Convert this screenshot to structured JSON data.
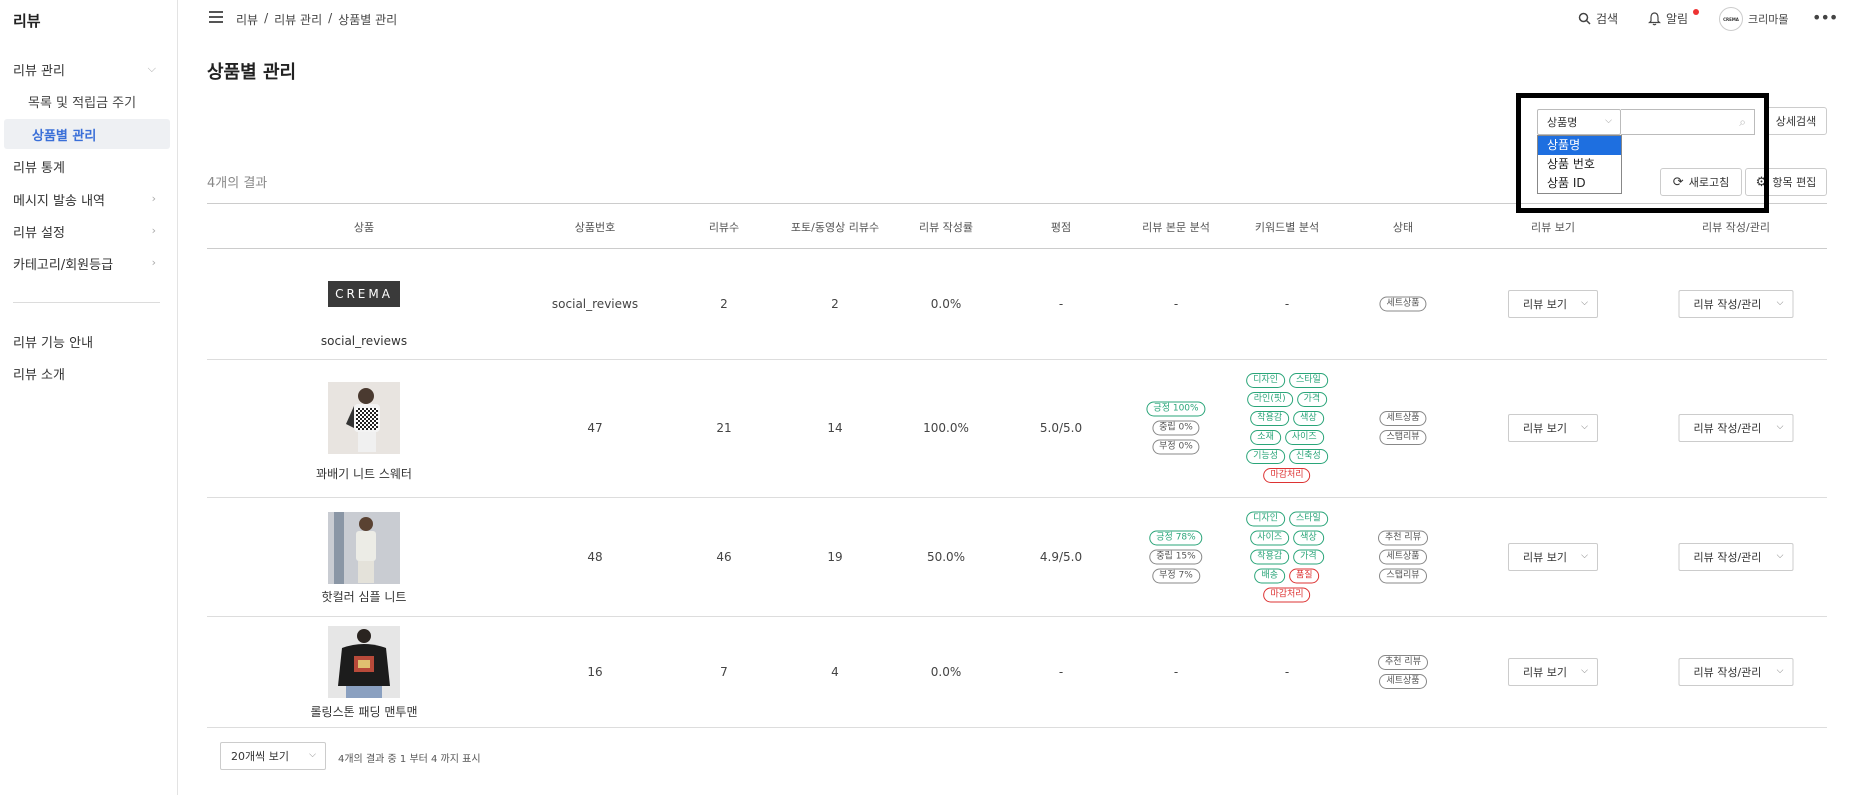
{
  "sidebar": {
    "title": "리뷰",
    "items": [
      {
        "label": "리뷰 관리"
      },
      {
        "label": "목록 및 적립금 주기"
      },
      {
        "label": "상품별 관리"
      },
      {
        "label": "리뷰 통계"
      },
      {
        "label": "메시지 발송 내역"
      },
      {
        "label": "리뷰 설정"
      },
      {
        "label": "카테고리/회원등급"
      },
      {
        "label": "리뷰 기능 안내"
      },
      {
        "label": "리뷰 소개"
      }
    ]
  },
  "topbar": {
    "breadcrumb": [
      "리뷰",
      "/",
      "리뷰 관리",
      "/",
      "상품별 관리"
    ],
    "search_label": "검색",
    "alert_label": "알림",
    "avatar_text": "CREMA",
    "user_label": "크리마몰"
  },
  "page": {
    "title": "상품별 관리"
  },
  "search": {
    "select_value": "상품명",
    "options": [
      "상품명",
      "상품 번호",
      "상품 ID"
    ],
    "detail_search_label": "상세검색",
    "refresh_label": "새로고침",
    "edit_columns_label": "항목 편집"
  },
  "results": {
    "count_label": "4개의 결과"
  },
  "table": {
    "headers": [
      "상품",
      "상품번호",
      "리뷰수",
      "포토/동영상 리뷰수",
      "리뷰 작성률",
      "평점",
      "리뷰 본문 분석",
      "키워드별 분석",
      "상태",
      "리뷰 보기",
      "리뷰 작성/관리"
    ],
    "rows": [
      {
        "name": "social_reviews",
        "logo_text": "CREMA",
        "code": "social_reviews",
        "reviews": "2",
        "photo_reviews": "2",
        "rate": "0.0%",
        "score": "-",
        "sentiment_text": "-",
        "keyword_text": "-",
        "status": [
          "세트상품"
        ],
        "view_label": "리뷰 보기",
        "manage_label": "리뷰 작성/관리"
      },
      {
        "name": "꽈배기 니트 스웨터",
        "code": "47",
        "reviews": "21",
        "photo_reviews": "14",
        "rate": "100.0%",
        "score": "5.0/5.0",
        "sentiment": [
          "긍정 100%",
          "중립 0%",
          "부정 0%"
        ],
        "keywords": [
          [
            "디자인",
            "스타일"
          ],
          [
            "라인(핏)",
            "가격"
          ],
          [
            "착용감",
            "색상"
          ],
          [
            "소재",
            "사이즈"
          ],
          [
            "기능성",
            "신축성"
          ],
          [
            "마감처리"
          ]
        ],
        "status": [
          "세트상품",
          "스탭리뷰"
        ],
        "view_label": "리뷰 보기",
        "manage_label": "리뷰 작성/관리"
      },
      {
        "name": "핫컬러 심플 니트",
        "code": "48",
        "reviews": "46",
        "photo_reviews": "19",
        "rate": "50.0%",
        "score": "4.9/5.0",
        "sentiment": [
          "긍정 78%",
          "중립 15%",
          "부정 7%"
        ],
        "keywords": [
          [
            "디자인",
            "스타일"
          ],
          [
            "사이즈",
            "색상"
          ],
          [
            "착용감",
            "가격"
          ],
          [
            "배송",
            "품질"
          ],
          [
            "마감처리"
          ]
        ],
        "status": [
          "추천 리뷰",
          "세트상품",
          "스탭리뷰"
        ],
        "view_label": "리뷰 보기",
        "manage_label": "리뷰 작성/관리"
      },
      {
        "name": "롤링스톤 패딩 맨투맨",
        "code": "16",
        "reviews": "7",
        "photo_reviews": "4",
        "rate": "0.0%",
        "score": "-",
        "sentiment_text": "-",
        "keyword_text": "-",
        "status": [
          "추천 리뷰",
          "세트상품"
        ],
        "view_label": "리뷰 보기",
        "manage_label": "리뷰 작성/관리"
      }
    ]
  },
  "pager": {
    "per_page": "20개씩 보기",
    "info": "4개의 결과 중 1 부터 4 까지 표시"
  },
  "colors": {
    "accent": "#3a6fd8",
    "positive": "#2aa579",
    "negative": "#d33333",
    "selected_option": "#1e6fe0"
  }
}
